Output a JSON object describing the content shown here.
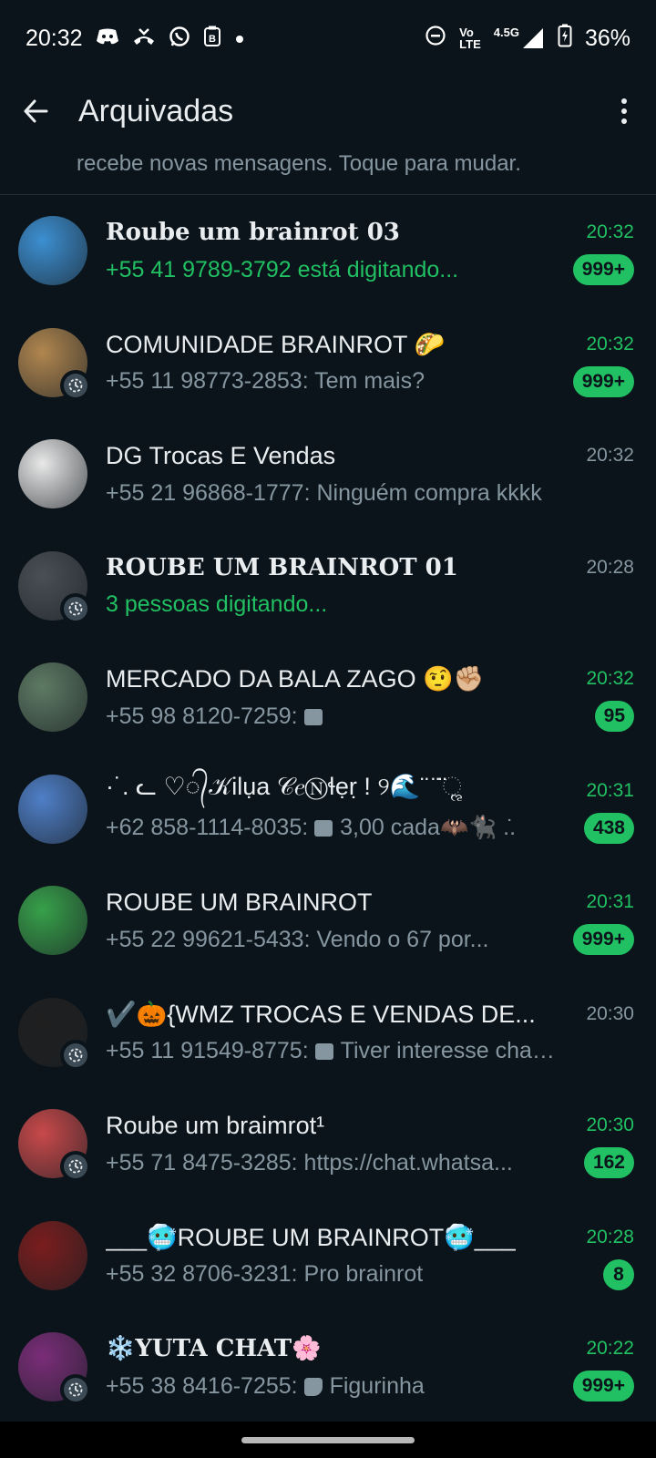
{
  "status_bar": {
    "time": "20:32",
    "icons": [
      "discord-icon",
      "missed-call-icon",
      "whatsapp-icon",
      "b-app-icon",
      "dot-icon"
    ],
    "right_icons": [
      "dnd-icon",
      "volte-icon",
      "signal-icon",
      "battery-charging-icon"
    ],
    "volte_top": "Vo",
    "volte_bottom": "LTE",
    "network": "4.5G",
    "battery": "36%"
  },
  "app_bar": {
    "title": "Arquivadas",
    "back_icon": "arrow-back-icon",
    "menu_icon": "more-vert-icon"
  },
  "notice": {
    "text": "recebe novas mensagens. Toque para mudar."
  },
  "chats": [
    {
      "name": "Roube um brainrot 03",
      "time": "20:32",
      "preview": "+55 41 9789-3792 está digitando...",
      "badge": "999+",
      "avatar_color": "#3c8fd1"
    },
    {
      "name": "COMUNIDADE BRAINROT 🌮",
      "time": "20:32",
      "preview": "+55 11 98773-2853: Tem mais?",
      "badge": "999+",
      "avatar_color": "#b0864f"
    },
    {
      "name": "DG Trocas E Vendas",
      "time": "20:32",
      "preview": "+55 21 96868-1777: Ninguém compra kkkk",
      "badge": "",
      "avatar_color": "#e8e8e8"
    },
    {
      "name": "ROUBE UM BRAINROT 01",
      "time": "20:28",
      "preview": "3 pessoas digitando...",
      "badge": "",
      "avatar_color": "#4a4f55"
    },
    {
      "name": "MERCADO DA BALA  ZAGO 🤨✊🏼",
      "time": "20:32",
      "preview": "+55 98 8120-7259: ",
      "badge": "95",
      "avatar_color": "#5d7a63"
    },
    {
      "name": "·˙. ᓚ ♡᭄𝒦ilụa 𝒞𝑒Ⓝɬẹṛ ! ୨🌊¨ ̈ ̈ૢ",
      "time": "20:31",
      "preview": "+62 858-1114-8035: 3,00 cada🦇🐈‍⬛ .̇.",
      "badge": "438",
      "avatar_color": "#4f7fc7"
    },
    {
      "name": "ROUBE UM BRAINROT",
      "time": "20:31",
      "preview": "+55 22 99621-5433: Vendo o 67 por...",
      "badge": "999+",
      "avatar_color": "#37a04a"
    },
    {
      "name": "✔️🎃{WMZ TROCAS E VENDAS DE...",
      "time": "20:30",
      "preview": "+55 11 91549-8775: Tiver interesse cham...",
      "badge": "",
      "avatar_color": "#1f1f1f"
    },
    {
      "name": "Roube um braimrot¹",
      "time": "20:30",
      "preview": "+55 71 8475-3285: https://chat.whatsa...",
      "badge": "162",
      "avatar_color": "#c8494a"
    },
    {
      "name": "___🥶ROUBE UM BRAINROT🥶___",
      "time": "20:28",
      "preview": "+55 32 8706-3231: Pro brainrot",
      "badge": "8",
      "avatar_color": "#7a1d1d"
    },
    {
      "name": "❄️YUTA CHAT🌸",
      "time": "20:22",
      "preview": "+55 38 8416-7255: Figurinha",
      "badge": "999+",
      "avatar_color": "#7a2d78"
    }
  ],
  "colors": {
    "background": "#0b141a",
    "accent_green": "#21c063",
    "secondary_text": "#8696a0"
  }
}
